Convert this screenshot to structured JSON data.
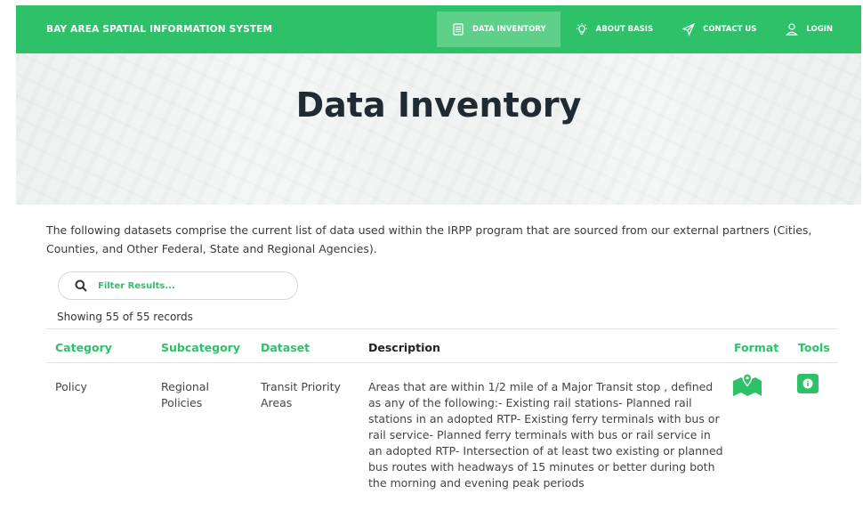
{
  "nav": {
    "brand": "BAY AREA SPATIAL INFORMATION SYSTEM",
    "items": [
      {
        "label": "DATA INVENTORY",
        "icon": "data-inventory-icon",
        "active": true
      },
      {
        "label": "ABOUT BASIS",
        "icon": "lightbulb-icon",
        "active": false
      },
      {
        "label": "CONTACT US",
        "icon": "paper-plane-icon",
        "active": false
      },
      {
        "label": "LOGIN",
        "icon": "user-icon",
        "active": false
      }
    ]
  },
  "hero": {
    "title": "Data Inventory"
  },
  "intro": "The following datasets comprise the current list of data used within the IRPP program that are sourced from our external partners (Cities, Counties, and Other Federal, State and Regional Agencies).",
  "filter": {
    "placeholder": "Filter Results..."
  },
  "showing": "Showing 55 of 55 records",
  "table": {
    "headers": [
      "Category",
      "Subcategory",
      "Dataset",
      "Description",
      "Format",
      "Tools"
    ],
    "rows": [
      {
        "category": "Policy",
        "subcategory": "Regional Policies",
        "dataset": "Transit Priority Areas",
        "description": "Areas that are within 1/2 mile of a Major Transit stop , defined as any of the following:- Existing rail stations- Planned rail stations in an adopted RTP- Existing ferry terminals with bus or rail service- Planned ferry terminals with bus or rail service in an adopted RTP- Intersection of at least two existing or planned bus routes with headways of 15 minutes or better during both the morning and evening peak periods",
        "format_icon": "map-icon",
        "tool_icon": "info-icon"
      }
    ]
  },
  "colors": {
    "accent": "#2ec16a",
    "active_nav": "#5fd08a"
  }
}
